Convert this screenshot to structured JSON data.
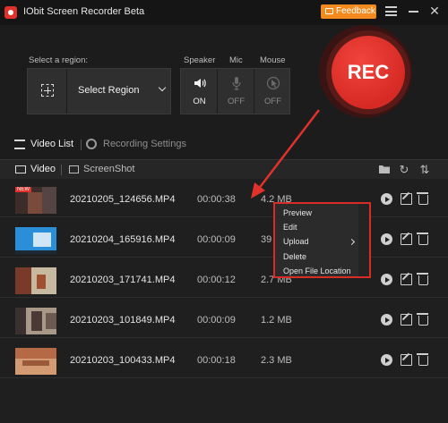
{
  "app": {
    "title": "IObit Screen Recorder Beta",
    "feedback_label": "Feedback"
  },
  "controls": {
    "region_caption": "Select a region:",
    "region_value": "Select Region",
    "audio": [
      {
        "caption": "Speaker",
        "state": "ON"
      },
      {
        "caption": "Mic",
        "state": "OFF"
      },
      {
        "caption": "Mouse",
        "state": "OFF"
      }
    ],
    "rec_label": "REC"
  },
  "tabs": {
    "video_list": "Video List",
    "recording_settings": "Recording Settings"
  },
  "subbar": {
    "video": "Video",
    "screenshot": "ScreenShot"
  },
  "rows": [
    {
      "name": "20210205_124656.MP4",
      "duration": "00:00:38",
      "size": "4.2 MB",
      "thumb_colors": [
        "#7a4a3a",
        "#3c2d2a"
      ],
      "badge": "NEW"
    },
    {
      "name": "20210204_165916.MP4",
      "duration": "00:00:09",
      "size": "39",
      "thumb_colors": [
        "#2a8ed8",
        "#cfe6f7"
      ],
      "badge": ""
    },
    {
      "name": "20210203_171741.MP4",
      "duration": "00:00:12",
      "size": "2.7 MB",
      "thumb_colors": [
        "#7a3a2a",
        "#c7b8a0"
      ],
      "badge": ""
    },
    {
      "name": "20210203_101849.MP4",
      "duration": "00:00:09",
      "size": "1.2 MB",
      "thumb_colors": [
        "#3a3030",
        "#a89888"
      ],
      "badge": ""
    },
    {
      "name": "20210203_100433.MP4",
      "duration": "00:00:18",
      "size": "2.3 MB",
      "thumb_colors": [
        "#b56a45",
        "#d49a72"
      ],
      "badge": ""
    }
  ],
  "context_menu": [
    "Preview",
    "Edit",
    "Upload",
    "Delete",
    "Open File Location"
  ],
  "colors": {
    "accent_red": "#e0322b",
    "feedback_orange": "#f28a1e",
    "bg": "#1f1f1f"
  }
}
